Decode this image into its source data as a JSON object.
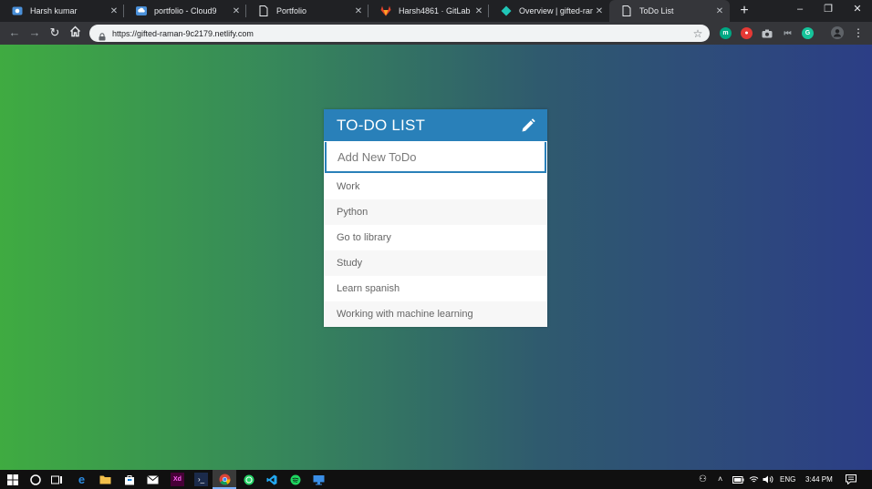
{
  "browser": {
    "tabs": [
      {
        "title": "Harsh kumar",
        "icon": "photo-app-icon",
        "active": false
      },
      {
        "title": "portfolio - Cloud9",
        "icon": "cloud9-icon",
        "active": false
      },
      {
        "title": "Portfolio",
        "icon": "document-icon",
        "active": false
      },
      {
        "title": "Harsh4861 · GitLab",
        "icon": "gitlab-icon",
        "active": false
      },
      {
        "title": "Overview | gifted-raman",
        "icon": "netlify-icon",
        "active": false
      },
      {
        "title": "ToDo List",
        "icon": "document-icon",
        "active": true
      }
    ],
    "new_tab_label": "+",
    "url": "https://gifted-raman-9c2179.netlify.com",
    "extensions": [
      "meet-icon",
      "record-icon",
      "camera-icon",
      "media-icon",
      "grammarly-icon",
      "profile-icon",
      "more-icon"
    ]
  },
  "todo": {
    "title": "TO-DO LIST",
    "input_placeholder": "Add New ToDo",
    "items": [
      "Work",
      "Python",
      "Go to library",
      "Study",
      "Learn spanish",
      "Working with machine learning"
    ]
  },
  "taskbar": {
    "apps": [
      "start-icon",
      "cortana-icon",
      "task-view-icon",
      "edge-icon",
      "file-explorer-icon",
      "store-icon",
      "mail-icon",
      "xd-icon",
      "powershell-icon",
      "chrome-icon",
      "whatsapp-icon",
      "vscode-icon",
      "spotify-icon",
      "remote-desktop-icon"
    ],
    "language": "ENG",
    "time": "3:44 PM"
  },
  "colors": {
    "header_blue": "#2980b9",
    "gradient_start": "#3fab41",
    "gradient_end": "#2c3e86"
  }
}
